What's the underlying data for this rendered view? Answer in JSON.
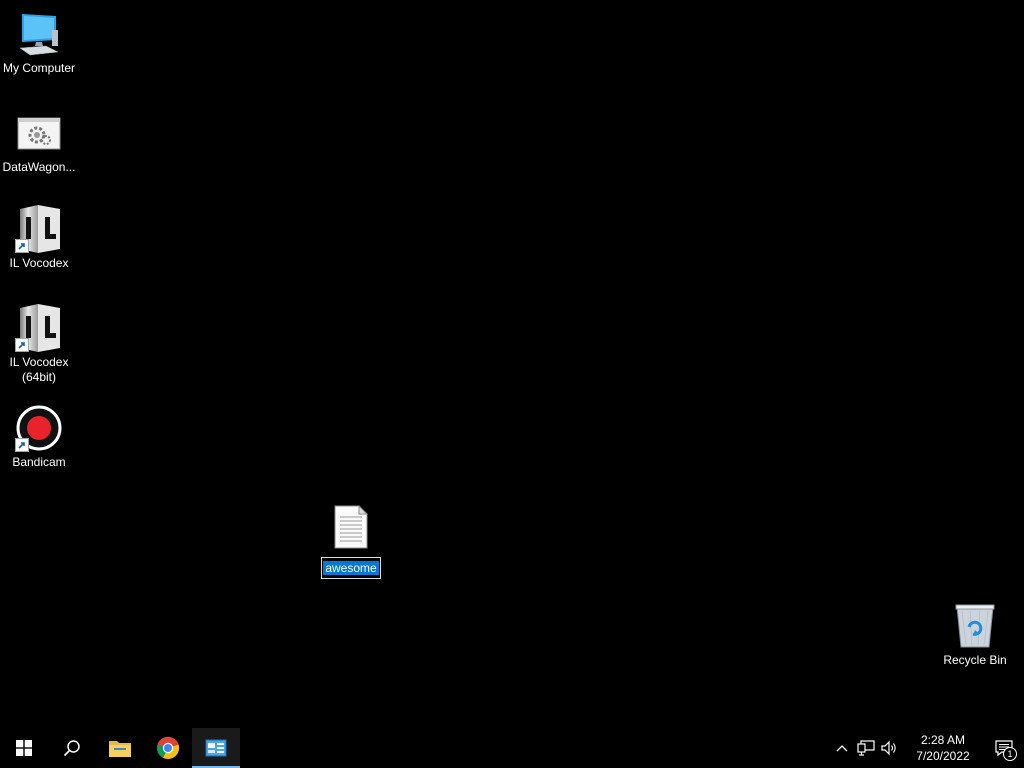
{
  "desktop": {
    "icons": [
      {
        "label": "My Computer",
        "icon": "computer-icon",
        "shortcut": false
      },
      {
        "label": "DataWagon...",
        "icon": "settings-window-icon",
        "shortcut": false
      },
      {
        "label": "IL Vocodex",
        "icon": "il-vocodex-icon",
        "shortcut": true
      },
      {
        "label": "IL Vocodex\n(64bit)",
        "icon": "il-vocodex-64-icon",
        "shortcut": true
      },
      {
        "label": "Bandicam",
        "icon": "bandicam-icon",
        "shortcut": true
      }
    ],
    "file": {
      "icon": "text-file-icon",
      "rename_value": "awesome"
    },
    "recycle_bin": {
      "label": "Recycle Bin",
      "icon": "recycle-bin-icon"
    }
  },
  "taskbar": {
    "start": {
      "icon": "windows-start-icon"
    },
    "search": {
      "icon": "search-icon"
    },
    "pinned": [
      {
        "name": "File Explorer",
        "icon": "file-explorer-icon"
      },
      {
        "name": "Google Chrome",
        "icon": "chrome-icon"
      },
      {
        "name": "Control Panel",
        "icon": "control-panel-icon",
        "active": true
      }
    ],
    "tray": {
      "icons": [
        "chevron-up-icon",
        "network-icon",
        "volume-icon"
      ],
      "time": "2:28 AM",
      "date": "7/20/2022",
      "notification_count": "1"
    }
  },
  "colors": {
    "desktop_bg": "#000000",
    "selection": "#0078d7",
    "active_underline": "#76b9ed"
  }
}
